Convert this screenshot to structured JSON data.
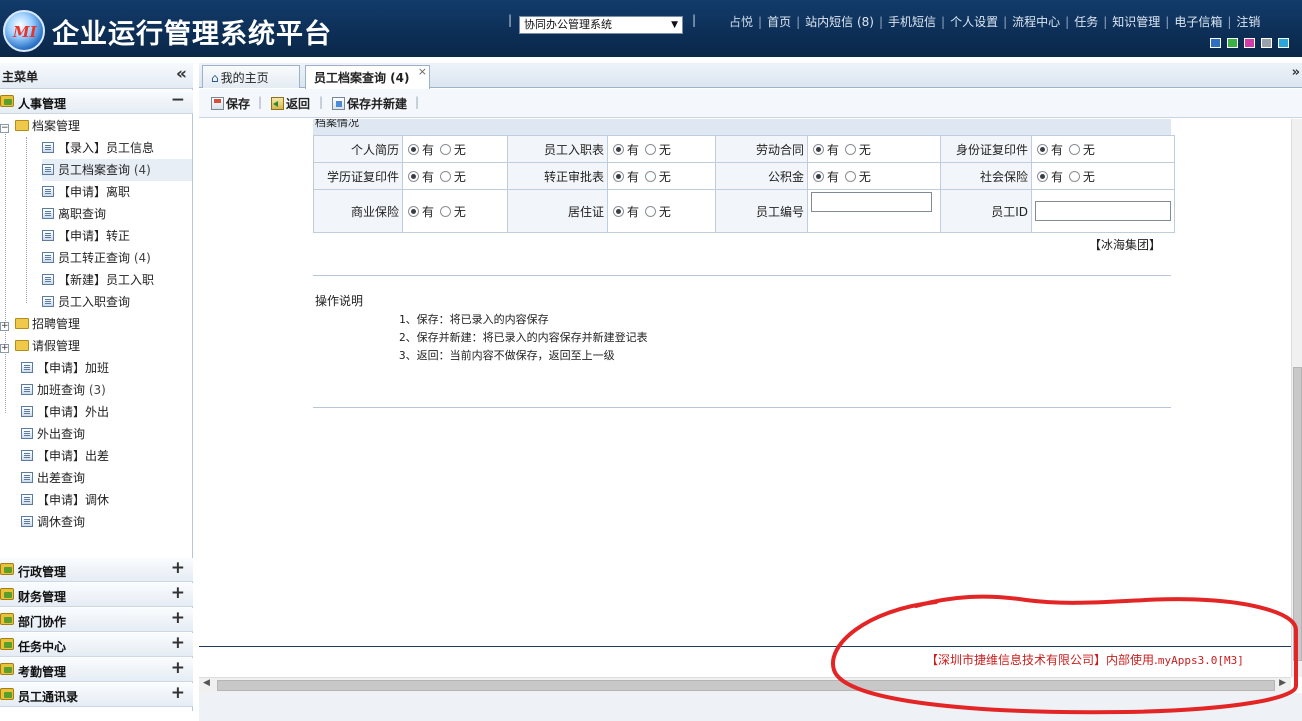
{
  "header": {
    "logo_text": "MI",
    "title": "企业运行管理系统平台",
    "system_select": "协同办公管理系统",
    "user": "占悦",
    "nav": [
      "首页",
      "站内短信 (8)",
      "手机短信",
      "个人设置",
      "流程中心",
      "任务",
      "知识管理",
      "电子信箱",
      "注销"
    ],
    "theme_colors": [
      "#2f6fc0",
      "#3cb043",
      "#d23aa8",
      "#9aa3ad",
      "#2ba6d9"
    ]
  },
  "sidebar": {
    "title": "主菜单",
    "collapse_glyph": "«",
    "active_category": "人事管理",
    "active_toggle": "−",
    "folder_archive": "档案管理",
    "archive_items": [
      {
        "label": "【录入】员工信息",
        "count": ""
      },
      {
        "label": "员工档案查询",
        "count": "(4)"
      },
      {
        "label": "【申请】离职",
        "count": ""
      },
      {
        "label": "离职查询",
        "count": ""
      },
      {
        "label": "【申请】转正",
        "count": ""
      },
      {
        "label": "员工转正查询",
        "count": "(4)"
      },
      {
        "label": "【新建】员工入职",
        "count": ""
      },
      {
        "label": "员工入职查询",
        "count": ""
      }
    ],
    "folder_recruit": "招聘管理",
    "folder_leave": "请假管理",
    "other_items": [
      {
        "label": "【申请】加班",
        "count": ""
      },
      {
        "label": "加班查询",
        "count": "(3)"
      },
      {
        "label": "【申请】外出",
        "count": ""
      },
      {
        "label": "外出查询",
        "count": ""
      },
      {
        "label": "【申请】出差",
        "count": ""
      },
      {
        "label": "出差查询",
        "count": ""
      },
      {
        "label": "【申请】调休",
        "count": ""
      },
      {
        "label": "调休查询",
        "count": ""
      }
    ],
    "categories": [
      "行政管理",
      "财务管理",
      "部门协作",
      "任务中心",
      "考勤管理",
      "员工通讯录"
    ],
    "expand_glyph": "+"
  },
  "tabs": [
    {
      "label": "我的主页",
      "active": false
    },
    {
      "label": "员工档案查询 (4)",
      "active": true
    }
  ],
  "tab_close": "×",
  "tab_scroll": "»",
  "toolbar": {
    "save": "保存",
    "back": "返回",
    "save_new": "保存并新建"
  },
  "form": {
    "section_title": "档案情况",
    "yes": "有",
    "no": "无",
    "rows": [
      [
        {
          "label": "个人简历",
          "value": "有"
        },
        {
          "label": "员工入职表",
          "value": "有"
        },
        {
          "label": "劳动合同",
          "value": "有"
        },
        {
          "label": "身份证复印件",
          "value": "有"
        }
      ],
      [
        {
          "label": "学历证复印件",
          "value": "有"
        },
        {
          "label": "转正审批表",
          "value": "有"
        },
        {
          "label": "公积金",
          "value": "有"
        },
        {
          "label": "社会保险",
          "value": "有"
        }
      ]
    ],
    "row3": {
      "biz_insurance": "商业保险",
      "residence": "居住证",
      "employee_no": "员工编号",
      "employee_id": "员工ID",
      "employee_no_value": "",
      "employee_id_value": ""
    },
    "company": "【冰海集团】"
  },
  "instructions": {
    "title": "操作说明",
    "items": [
      "1、保存：将已录入的内容保存",
      "2、保存并新建：将已录入的内容保存并新建登记表",
      "3、返回：当前内容不做保存，返回至上一级"
    ]
  },
  "footer": {
    "company": "【深圳市捷维信息技术有限公司】内部使用.",
    "version": "myApps3.0[M3]"
  }
}
